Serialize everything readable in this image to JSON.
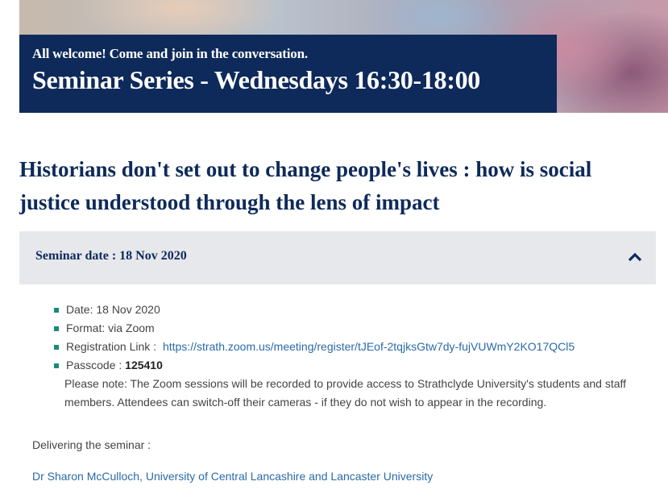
{
  "hero": {
    "subtitle": "All welcome! Come and join in the conversation.",
    "title": "Seminar Series - Wednesdays 16:30-18:00"
  },
  "headline": "Historians don't set out to change people's lives : how is social justice understood through the lens of impact",
  "accordion": {
    "label": "Seminar date : 18 Nov 2020",
    "state_icon": "chevron-up-icon"
  },
  "details": {
    "date": "Date: 18 Nov 2020",
    "format": "Format: via Zoom",
    "registration_label": "Registration Link :",
    "registration_url": "https://strath.zoom.us/meeting/register/tJEof-2tqjksGtw7dy-fujVUWmY2KO17QCl5",
    "passcode_label": "Passcode :",
    "passcode_value": "125410",
    "note": "Please note: The Zoom sessions will be recorded to provide access to Strathclyde University's students and staff members. Attendees can switch-off their cameras - if they do not wish to appear in the recording."
  },
  "delivering_label": "Delivering the seminar :",
  "speaker": "Dr Sharon McCulloch, University of Central Lancashire and Lancaster University",
  "colors": {
    "navy": "#0e2a5a",
    "bullet_teal": "#1b8a7a",
    "link_blue": "#2a6aa8",
    "accordion_bg": "#e6e8eb"
  }
}
